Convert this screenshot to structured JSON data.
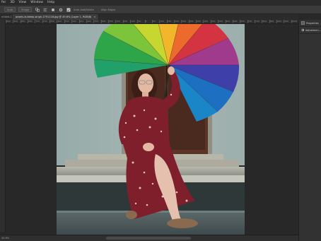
{
  "menu": {
    "items": [
      "fer",
      "3D",
      "View",
      "Window",
      "Help"
    ]
  },
  "options": {
    "field1": "Auto",
    "field2": "Shape",
    "auto_add_delete": "Auto Add/Delete",
    "align_edges": "Align Edges"
  },
  "tabs": {
    "side_label": "ntitled-1",
    "active_doc": "pexels-kuldeep-singh-1791116.jpg @ 49.6% (Layer 1, RGB/8)",
    "active_close": "×"
  },
  "ruler": {
    "labels": [
      "950",
      "900",
      "850",
      "800",
      "750",
      "700",
      "650",
      "600",
      "550",
      "500",
      "450",
      "400",
      "350",
      "300",
      "250",
      "200",
      "150",
      "100",
      "50",
      "0",
      "50",
      "100",
      "150",
      "200",
      "250",
      "300",
      "350",
      "400",
      "450",
      "500",
      "550",
      "600",
      "650",
      "700",
      "750",
      "800",
      "850",
      "900",
      "950",
      "1000"
    ]
  },
  "panels": {
    "items": [
      {
        "label": "Properties",
        "icon": "properties-icon"
      },
      {
        "label": "Adjustmen...",
        "icon": "adjustments-icon"
      }
    ]
  },
  "status": {
    "zoom": "49.6%"
  },
  "colors": {
    "workspace_bg": "#282828",
    "panel_bg": "#323232",
    "tab_active": "#3c3c3c"
  }
}
